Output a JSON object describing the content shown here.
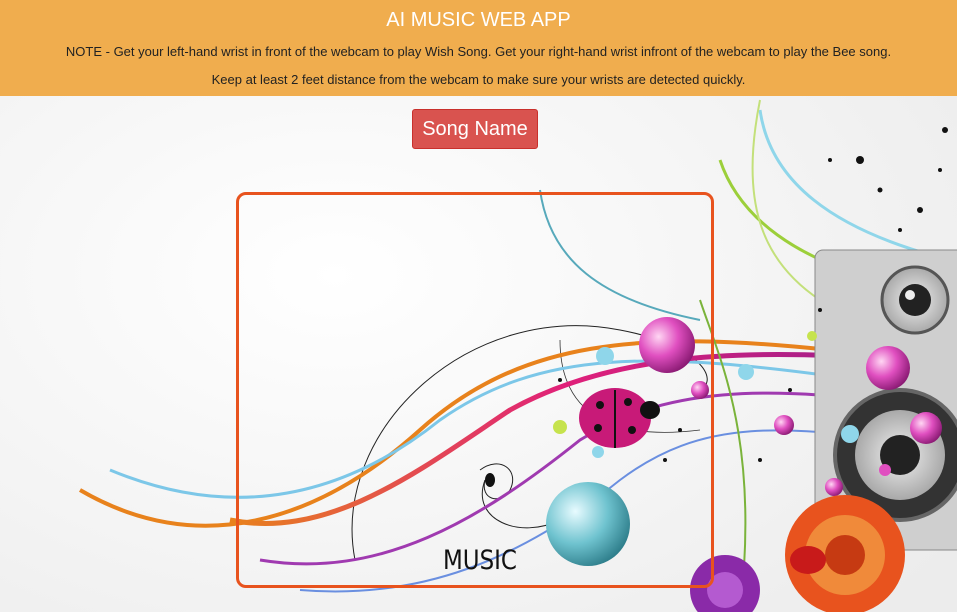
{
  "header": {
    "title": "AI MUSIC WEB APP",
    "note_line1": "NOTE - Get your left-hand wrist in front of the webcam to play Wish Song. Get your right-hand wrist infront of the webcam to play the Bee song.",
    "note_line2": "Keep at least 2 feet distance from the webcam to make sure your wrists are detected quickly."
  },
  "song_button": {
    "label": "Song Name"
  },
  "background": {
    "logo_text": "MUSIC"
  },
  "colors": {
    "header_bg": "#f0ad4e",
    "button_bg": "#d9534f",
    "webcam_border": "#e8531e"
  }
}
